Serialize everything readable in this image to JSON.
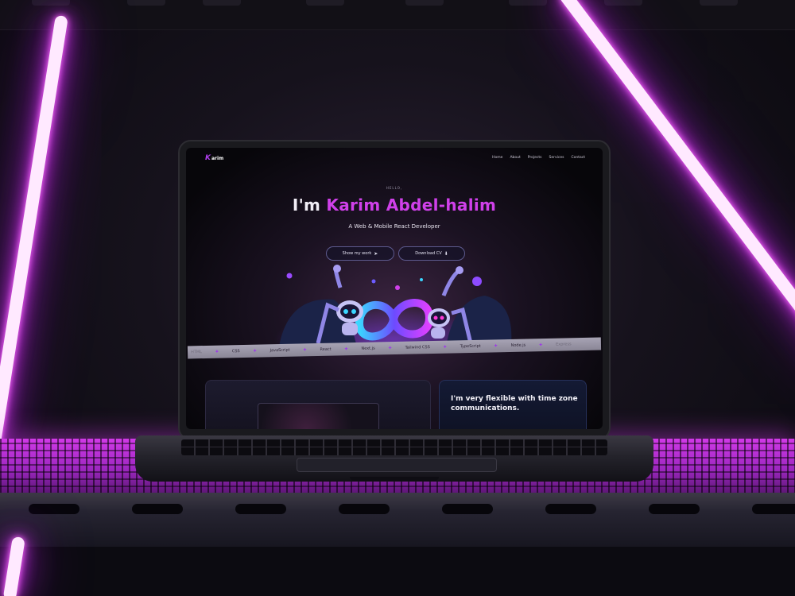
{
  "site": {
    "logo": {
      "mark": "K",
      "text": "arim"
    },
    "nav": [
      {
        "label": "Home"
      },
      {
        "label": "About"
      },
      {
        "label": "Projects"
      },
      {
        "label": "Services"
      },
      {
        "label": "Contact"
      }
    ]
  },
  "hero": {
    "greeting": "HELLO,",
    "headline_prefix": "I'm ",
    "headline_name": "Karim Abdel-halim",
    "subtitle": "A Web & Mobile React Developer",
    "buttons": [
      {
        "label": "Show my work",
        "icon": "send-icon",
        "glyph": "➤"
      },
      {
        "label": "Download CV",
        "icon": "download-icon",
        "glyph": "⬇"
      }
    ]
  },
  "marquee": {
    "separator": "✦",
    "items": [
      {
        "label": "HTML",
        "faded": true
      },
      {
        "label": "CSS",
        "faded": false
      },
      {
        "label": "JavaScript",
        "faded": false
      },
      {
        "label": "React",
        "faded": false
      },
      {
        "label": "Next.js",
        "faded": false
      },
      {
        "label": "Tailwind CSS",
        "faded": false
      },
      {
        "label": "TypeScript",
        "faded": false
      },
      {
        "label": "Node.js",
        "faded": false
      },
      {
        "label": "Express",
        "faded": true
      }
    ]
  },
  "cards": {
    "timezone_text": "I'm very flexible with time zone communications."
  },
  "colors": {
    "accent": "#d040ea",
    "neon": "#e13cff",
    "background": "#07060a"
  }
}
